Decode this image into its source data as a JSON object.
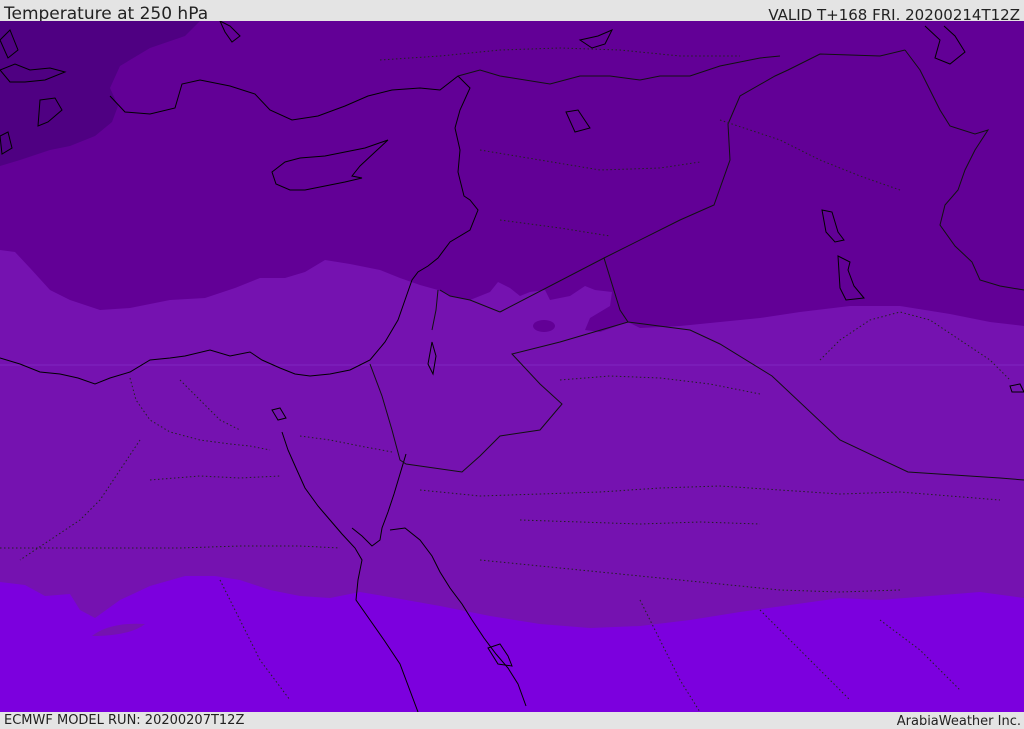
{
  "header": {
    "title": "Temperature at 250 hPa",
    "valid": "VALID T+168 FRI. 20200214T12Z"
  },
  "footer": {
    "model_run": "ECMWF MODEL RUN: 20200207T12Z",
    "credit": "ArabiaWeather Inc."
  },
  "map": {
    "region": "Eastern Mediterranean and Middle East",
    "colors": {
      "band_coldest": "#4f0082",
      "band_cold": "#620096",
      "band_mid": "#7512b0",
      "band_warm": "#7c00de",
      "coastline": "#000000",
      "border": "#111111"
    }
  }
}
